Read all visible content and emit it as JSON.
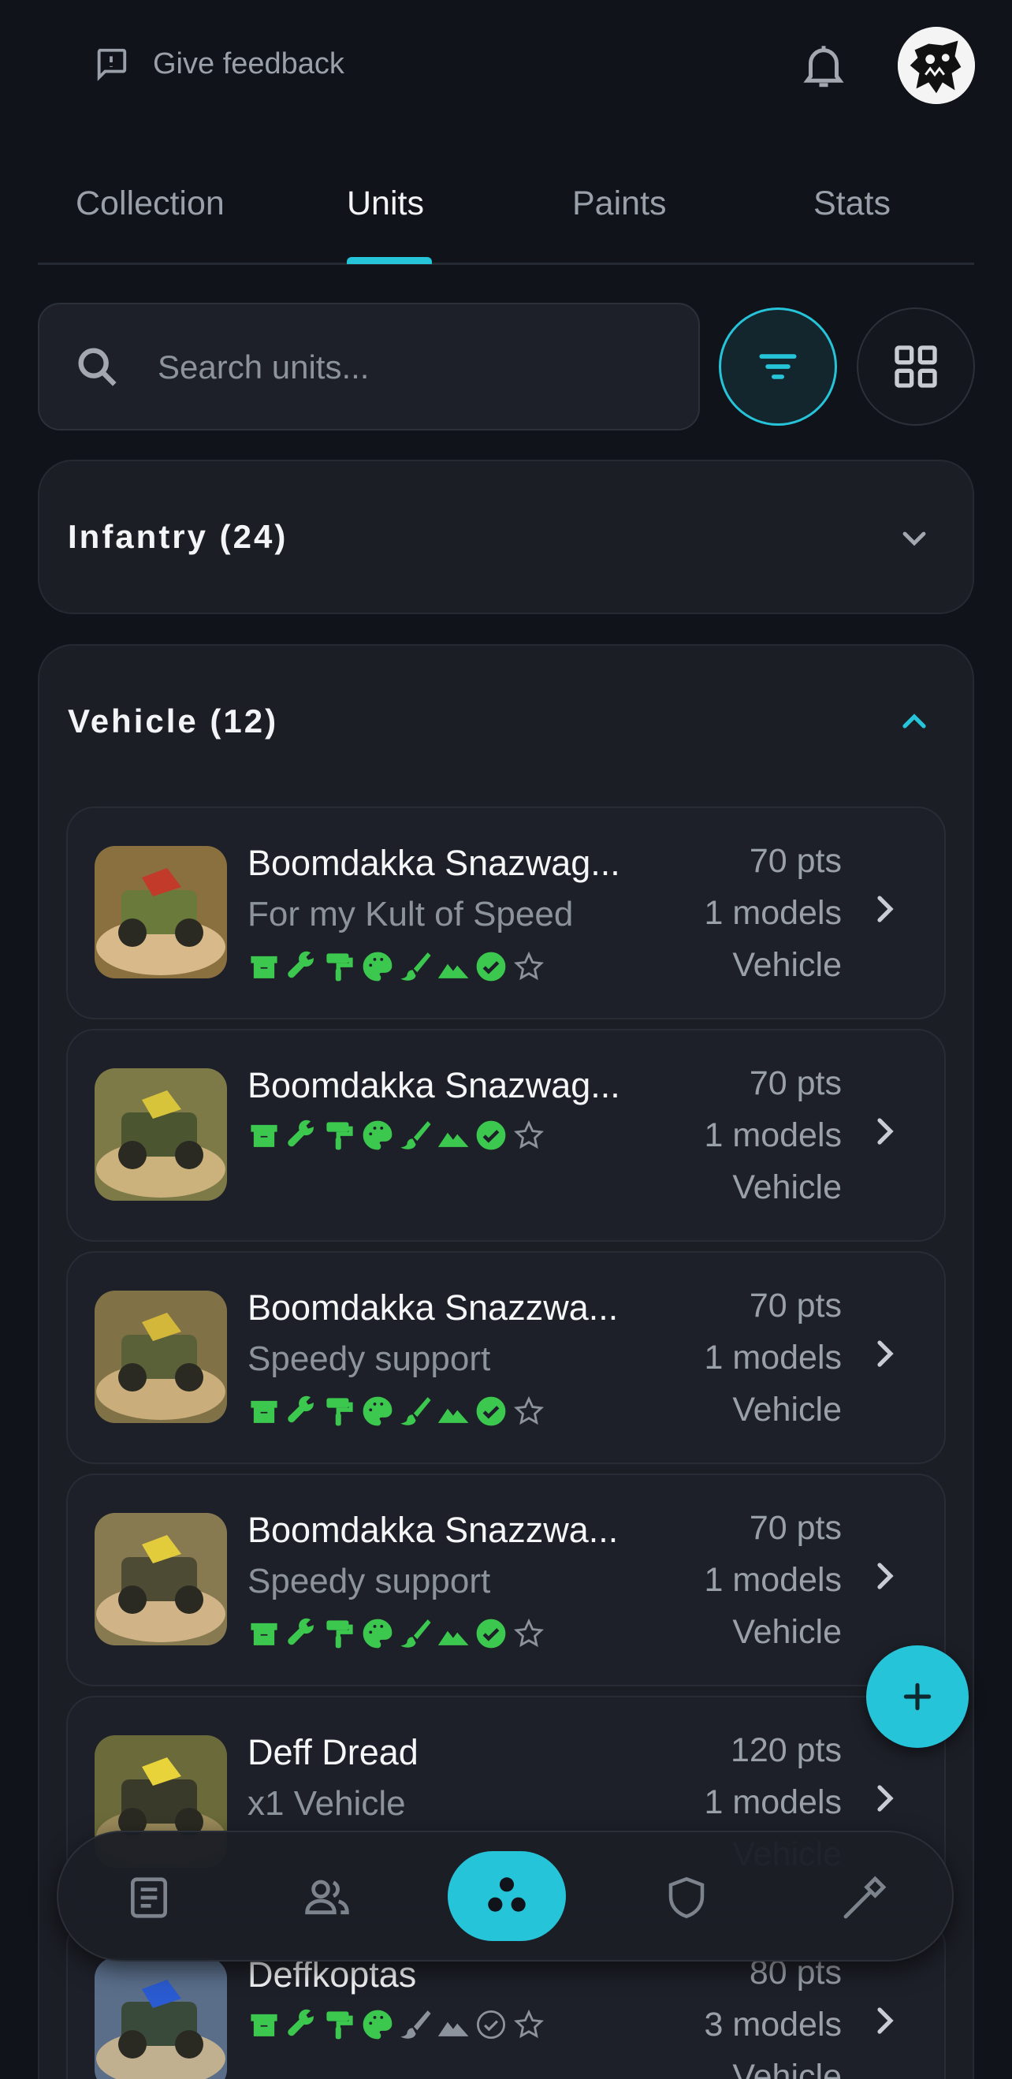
{
  "header": {
    "feedback_label": "Give feedback"
  },
  "tabs": [
    {
      "label": "Collection",
      "active": false
    },
    {
      "label": "Units",
      "active": true
    },
    {
      "label": "Paints",
      "active": false
    },
    {
      "label": "Stats",
      "active": false
    }
  ],
  "search": {
    "placeholder": "Search units..."
  },
  "groups": [
    {
      "title": "Infantry (24)",
      "expanded": false
    },
    {
      "title": "Vehicle (12)",
      "expanded": true
    }
  ],
  "units": [
    {
      "name": "Boomdakka Snazwag...",
      "subtitle": "For my Kult of Speed",
      "points": "70 pts",
      "models": "1 models",
      "type": "Vehicle",
      "progress_steps_done": 7
    },
    {
      "name": "Boomdakka Snazwag...",
      "subtitle": "",
      "points": "70 pts",
      "models": "1 models",
      "type": "Vehicle",
      "progress_steps_done": 7
    },
    {
      "name": "Boomdakka Snazzwa...",
      "subtitle": "Speedy support",
      "points": "70 pts",
      "models": "1 models",
      "type": "Vehicle",
      "progress_steps_done": 7
    },
    {
      "name": "Boomdakka Snazzwa...",
      "subtitle": "Speedy support",
      "points": "70 pts",
      "models": "1 models",
      "type": "Vehicle",
      "progress_steps_done": 7
    },
    {
      "name": "Deff Dread",
      "subtitle": "x1 Vehicle",
      "points": "120 pts",
      "models": "1 models",
      "type": "Vehicle"
    },
    {
      "name": "Deffkoptas",
      "subtitle": "",
      "points": "80 pts",
      "models": "3 models",
      "type": "Vehicle",
      "progress_steps_done": 4
    }
  ],
  "progress_icons": [
    "box-icon",
    "wrench-icon",
    "primer-roller-icon",
    "palette-icon",
    "brush-icon",
    "terrain-icon",
    "check-circle-icon",
    "star-icon"
  ],
  "colors": {
    "accent": "#26c4d9",
    "progress_done": "#3cc84e",
    "progress_todo": "#8d939c",
    "background": "#101319"
  },
  "bottom_nav": [
    "notes-icon",
    "users-icon",
    "units-icon",
    "shield-icon",
    "hammer-icon"
  ]
}
